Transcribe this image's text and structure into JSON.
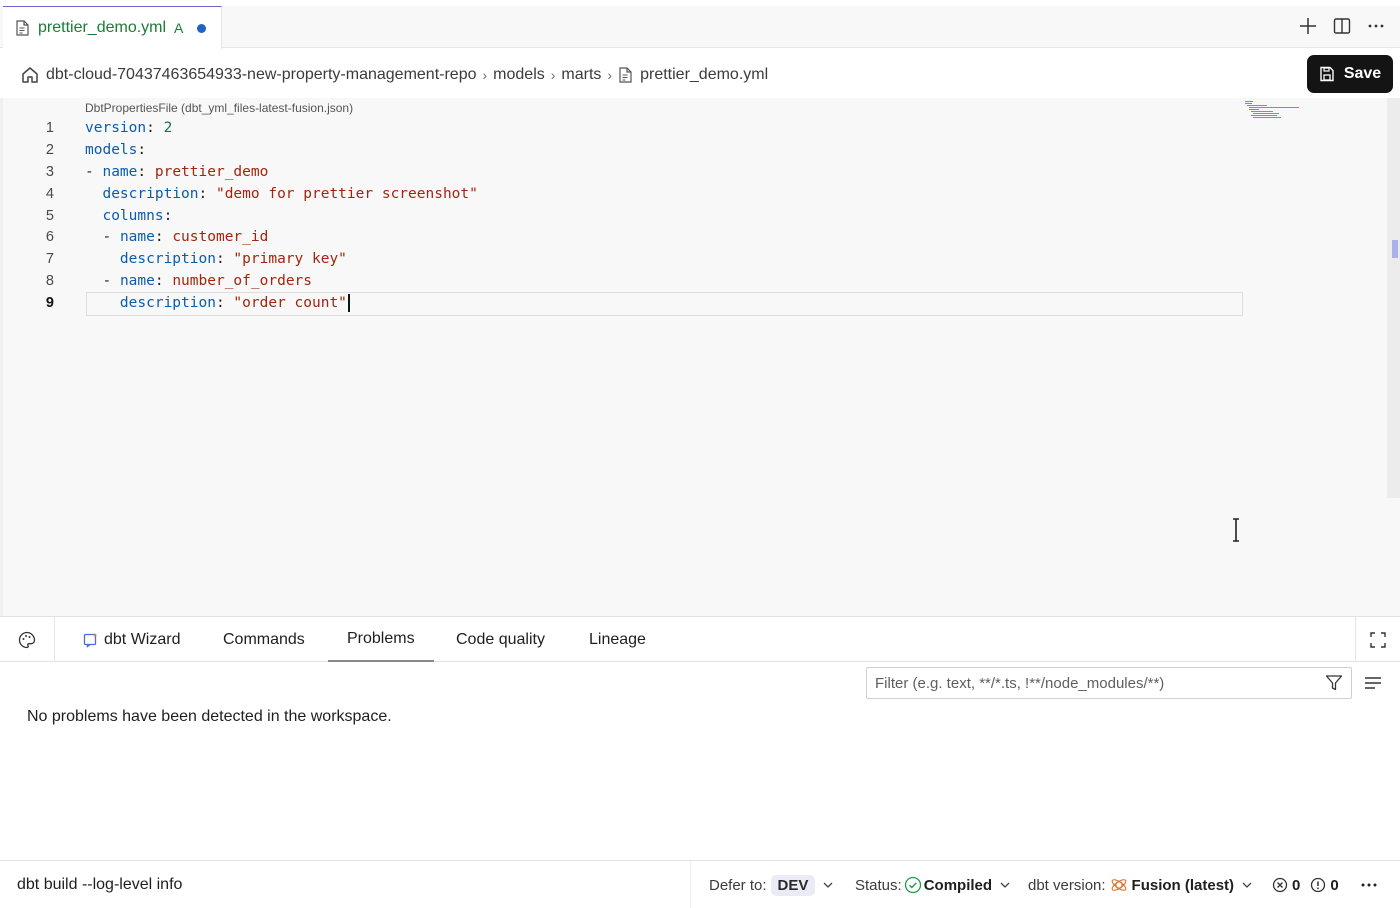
{
  "tab": {
    "filename": "prettier_demo.yml",
    "git_status": "A"
  },
  "breadcrumb": {
    "repo": "dbt-cloud-70437463654933-new-property-management-repo",
    "folder1": "models",
    "folder2": "marts",
    "file": "prettier_demo.yml"
  },
  "toolbar": {
    "save_label": "Save"
  },
  "editor": {
    "schema_hint": "DbtPropertiesFile (dbt_yml_files-latest-fusion.json)",
    "line_numbers": [
      "1",
      "2",
      "3",
      "4",
      "5",
      "6",
      "7",
      "8",
      "9"
    ],
    "lines": [
      {
        "indent": "",
        "dash": "",
        "key": "version",
        "value": "2"
      },
      {
        "indent": "",
        "dash": "",
        "key": "models",
        "value": ""
      },
      {
        "indent": "",
        "dash": "- ",
        "key": "name",
        "value": "prettier_demo"
      },
      {
        "indent": "  ",
        "dash": "",
        "key": "description",
        "value": "\"demo for prettier screenshot\""
      },
      {
        "indent": "  ",
        "dash": "",
        "key": "columns",
        "value": ""
      },
      {
        "indent": "  ",
        "dash": "- ",
        "key": "name",
        "value": "customer_id"
      },
      {
        "indent": "    ",
        "dash": "",
        "key": "description",
        "value": "\"primary key\""
      },
      {
        "indent": "  ",
        "dash": "- ",
        "key": "name",
        "value": "number_of_orders"
      },
      {
        "indent": "    ",
        "dash": "",
        "key": "description",
        "value": "\"order count\""
      }
    ]
  },
  "panel": {
    "tabs": [
      "dbt Wizard",
      "Commands",
      "Problems",
      "Code quality",
      "Lineage"
    ],
    "active_tab": "Problems",
    "filter_placeholder": "Filter (e.g. text, **/*.ts, !**/node_modules/**)",
    "message": "No problems have been detected in the workspace."
  },
  "statusbar": {
    "command": "dbt build --log-level info",
    "defer_label": "Defer to:",
    "defer_value": "DEV",
    "status_label": "Status:",
    "status_value": "Compiled",
    "version_label": "dbt version:",
    "version_value": "Fusion (latest)",
    "errors": "0",
    "warnings": "0"
  },
  "colors": {
    "accent": "#6c63d6",
    "yaml_key": "#0b5cad",
    "yaml_string": "#a1260d",
    "git_added": "#1e7a34",
    "save_bg": "#141414"
  }
}
